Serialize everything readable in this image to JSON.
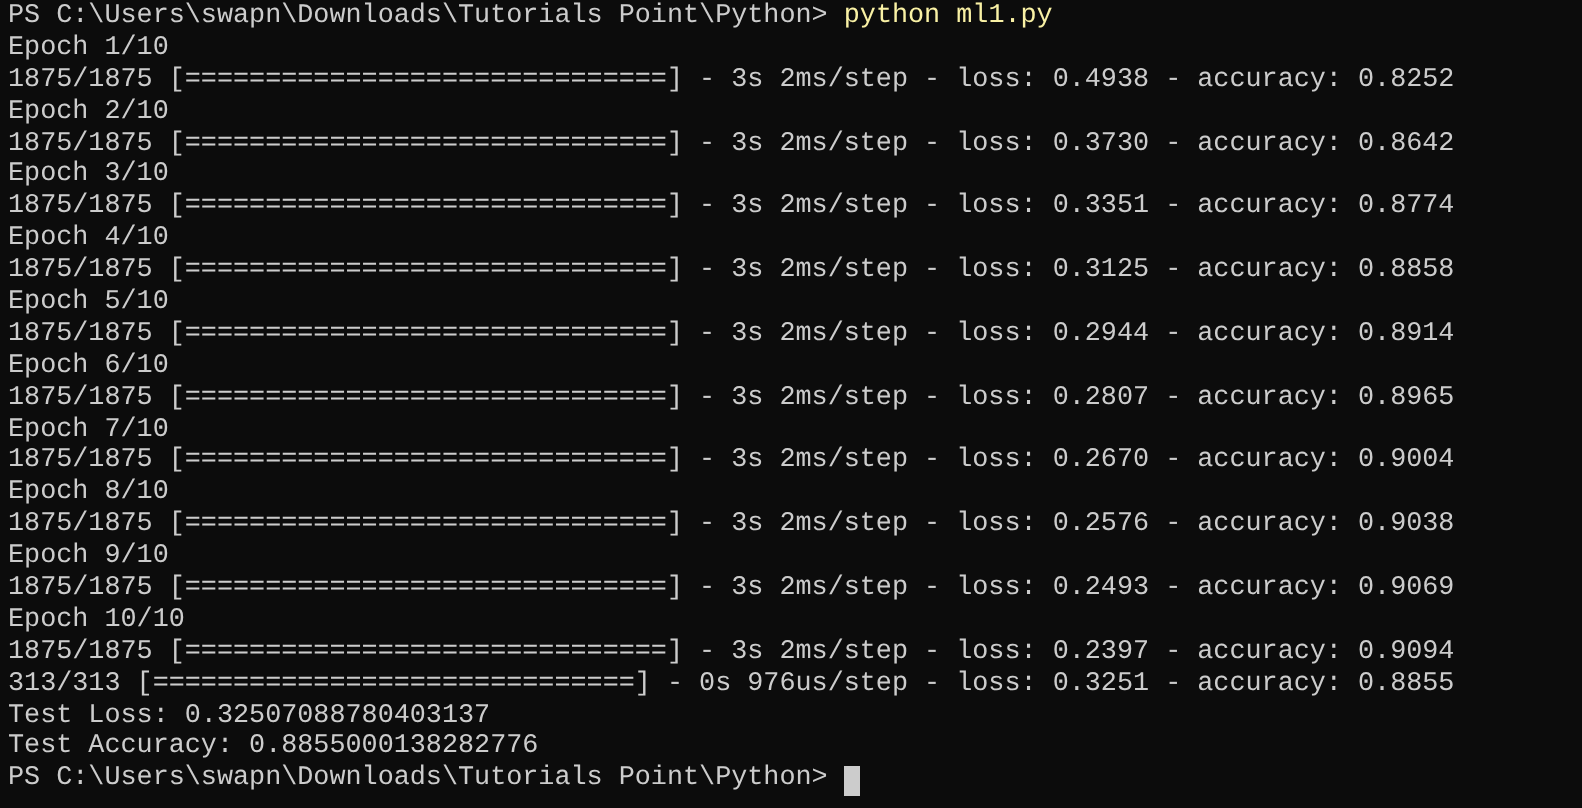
{
  "terminal": {
    "lines": [
      {
        "kind": "prompt",
        "prompt": "PS C:\\Users\\swapn\\Downloads\\Tutorials Point\\Python>",
        "command": "python ml1.py",
        "cursor": false
      },
      {
        "kind": "output",
        "text": "Epoch 1/10"
      },
      {
        "kind": "output",
        "text": "1875/1875 [==============================] - 3s 2ms/step - loss: 0.4938 - accuracy: 0.8252"
      },
      {
        "kind": "output",
        "text": "Epoch 2/10"
      },
      {
        "kind": "output",
        "text": "1875/1875 [==============================] - 3s 2ms/step - loss: 0.3730 - accuracy: 0.8642"
      },
      {
        "kind": "output",
        "text": "Epoch 3/10"
      },
      {
        "kind": "output",
        "text": "1875/1875 [==============================] - 3s 2ms/step - loss: 0.3351 - accuracy: 0.8774"
      },
      {
        "kind": "output",
        "text": "Epoch 4/10"
      },
      {
        "kind": "output",
        "text": "1875/1875 [==============================] - 3s 2ms/step - loss: 0.3125 - accuracy: 0.8858"
      },
      {
        "kind": "output",
        "text": "Epoch 5/10"
      },
      {
        "kind": "output",
        "text": "1875/1875 [==============================] - 3s 2ms/step - loss: 0.2944 - accuracy: 0.8914"
      },
      {
        "kind": "output",
        "text": "Epoch 6/10"
      },
      {
        "kind": "output",
        "text": "1875/1875 [==============================] - 3s 2ms/step - loss: 0.2807 - accuracy: 0.8965"
      },
      {
        "kind": "output",
        "text": "Epoch 7/10"
      },
      {
        "kind": "output",
        "text": "1875/1875 [==============================] - 3s 2ms/step - loss: 0.2670 - accuracy: 0.9004"
      },
      {
        "kind": "output",
        "text": "Epoch 8/10"
      },
      {
        "kind": "output",
        "text": "1875/1875 [==============================] - 3s 2ms/step - loss: 0.2576 - accuracy: 0.9038"
      },
      {
        "kind": "output",
        "text": "Epoch 9/10"
      },
      {
        "kind": "output",
        "text": "1875/1875 [==============================] - 3s 2ms/step - loss: 0.2493 - accuracy: 0.9069"
      },
      {
        "kind": "output",
        "text": "Epoch 10/10"
      },
      {
        "kind": "output",
        "text": "1875/1875 [==============================] - 3s 2ms/step - loss: 0.2397 - accuracy: 0.9094"
      },
      {
        "kind": "output",
        "text": "313/313 [==============================] - 0s 976us/step - loss: 0.3251 - accuracy: 0.8855"
      },
      {
        "kind": "output",
        "text": "Test Loss: 0.32507088780403137"
      },
      {
        "kind": "output",
        "text": "Test Accuracy: 0.8855000138282776"
      },
      {
        "kind": "prompt",
        "prompt": "PS C:\\Users\\swapn\\Downloads\\Tutorials Point\\Python>",
        "cursor": true
      }
    ]
  }
}
